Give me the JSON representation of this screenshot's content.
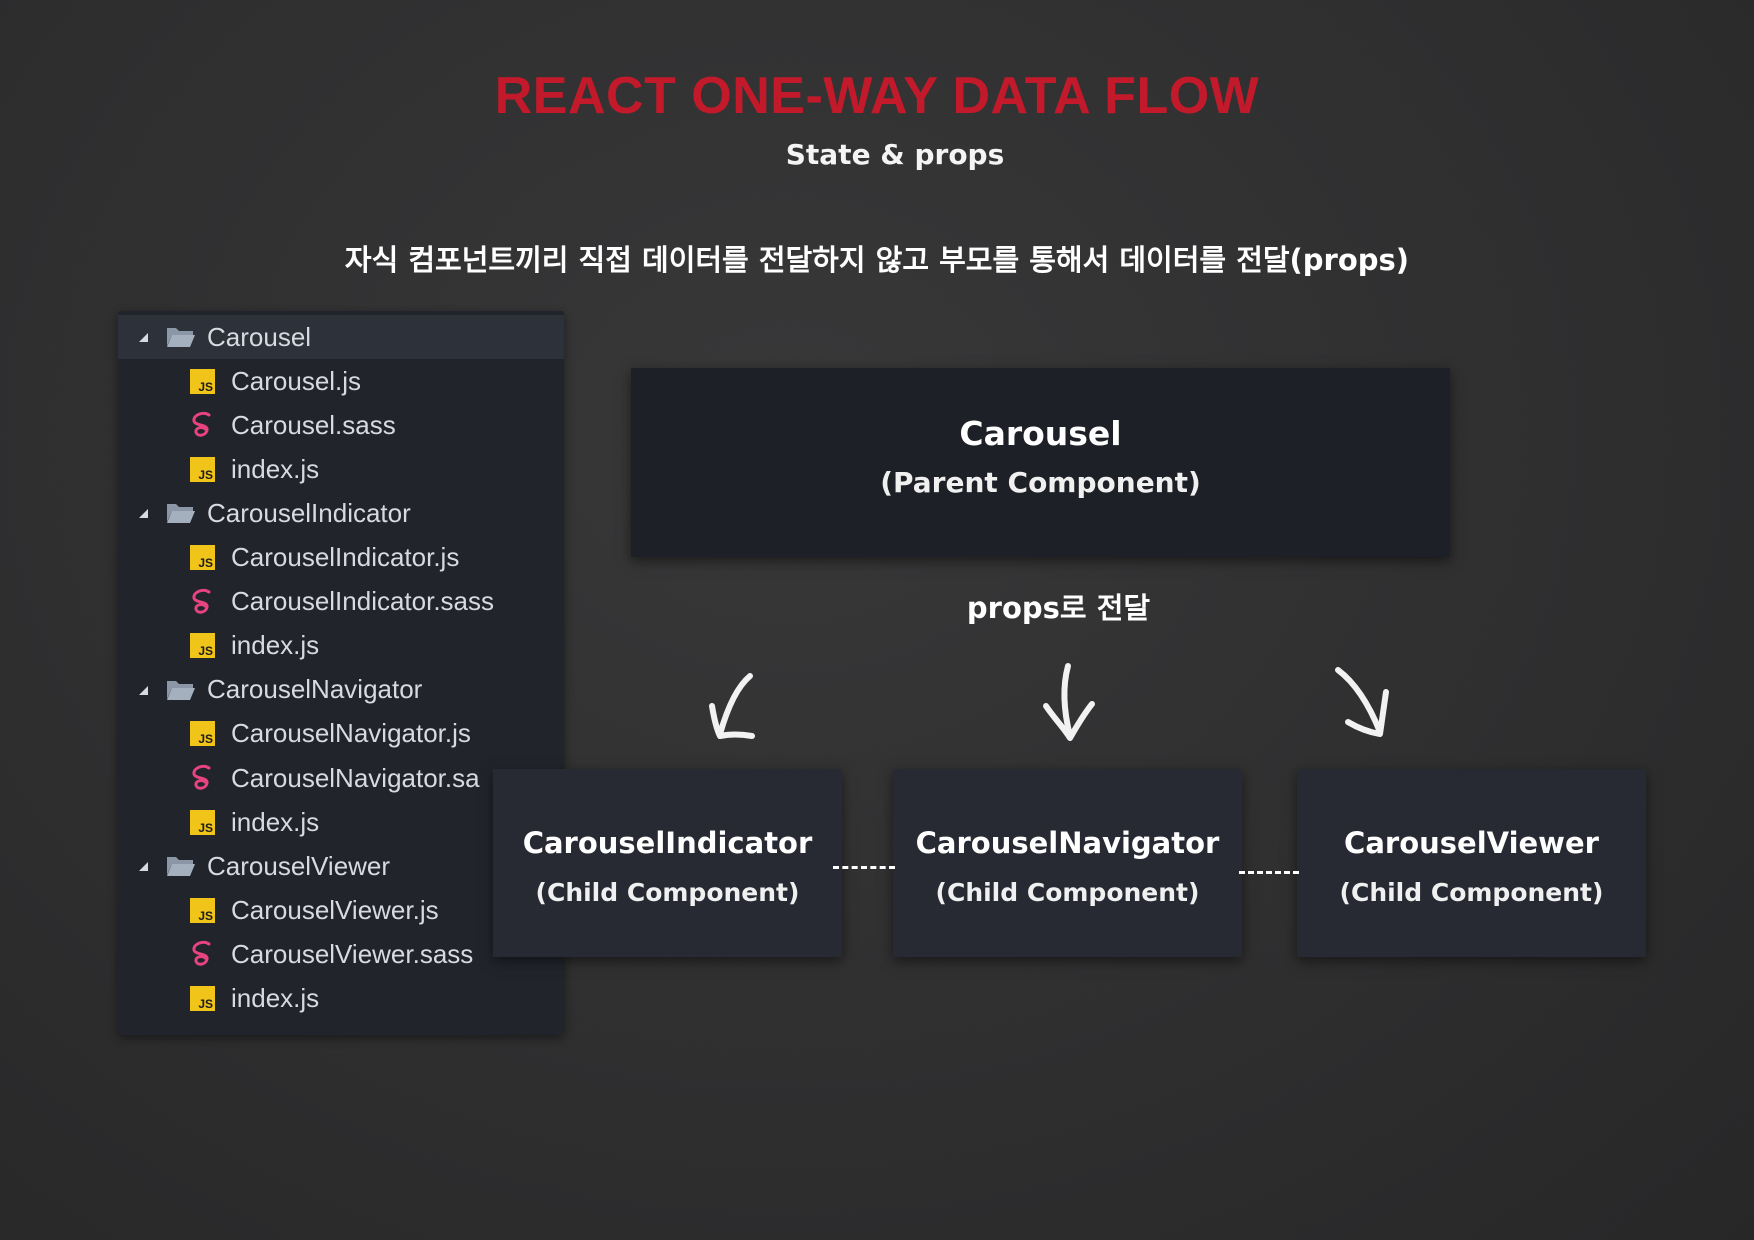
{
  "header": {
    "title": "REACT ONE-WAY DATA FLOW",
    "subtitle": "State & props",
    "description": "자식 컴포넌트끼리 직접 데이터를 전달하지 않고 부모를 통해서 데이터를 전달(props)"
  },
  "file_tree": {
    "items": [
      {
        "type": "folder",
        "label": "Carousel"
      },
      {
        "type": "js",
        "label": "Carousel.js"
      },
      {
        "type": "sass",
        "label": "Carousel.sass"
      },
      {
        "type": "js",
        "label": "index.js"
      },
      {
        "type": "folder",
        "label": "CarouselIndicator"
      },
      {
        "type": "js",
        "label": "CarouselIndicator.js"
      },
      {
        "type": "sass",
        "label": "CarouselIndicator.sass"
      },
      {
        "type": "js",
        "label": "index.js"
      },
      {
        "type": "folder",
        "label": "CarouselNavigator"
      },
      {
        "type": "js",
        "label": "CarouselNavigator.js"
      },
      {
        "type": "sass",
        "label": "CarouselNavigator.sa"
      },
      {
        "type": "js",
        "label": "index.js"
      },
      {
        "type": "folder",
        "label": "CarouselViewer"
      },
      {
        "type": "js",
        "label": "CarouselViewer.js"
      },
      {
        "type": "sass",
        "label": "CarouselViewer.sass"
      },
      {
        "type": "js",
        "label": "index.js"
      }
    ],
    "js_badge": "JS",
    "icons": {
      "folder": "folder-open-icon",
      "js": "js-file-icon",
      "sass": "sass-file-icon",
      "expander": "caret-down-icon"
    },
    "colors": {
      "js": "#f0c419",
      "sass": "#e6437f",
      "folder": "#8b97a7"
    }
  },
  "diagram": {
    "parent": {
      "title": "Carousel",
      "subtitle": "(Parent Component)"
    },
    "flow_label": "props로 전달",
    "children": [
      {
        "title": "CarouselIndicator",
        "subtitle": "(Child Component)"
      },
      {
        "title": "CarouselNavigator",
        "subtitle": "(Child Component)"
      },
      {
        "title": "CarouselViewer",
        "subtitle": "(Child Component)"
      }
    ],
    "colors": {
      "title": "#c21a2b",
      "background": "#2f2f30"
    }
  }
}
